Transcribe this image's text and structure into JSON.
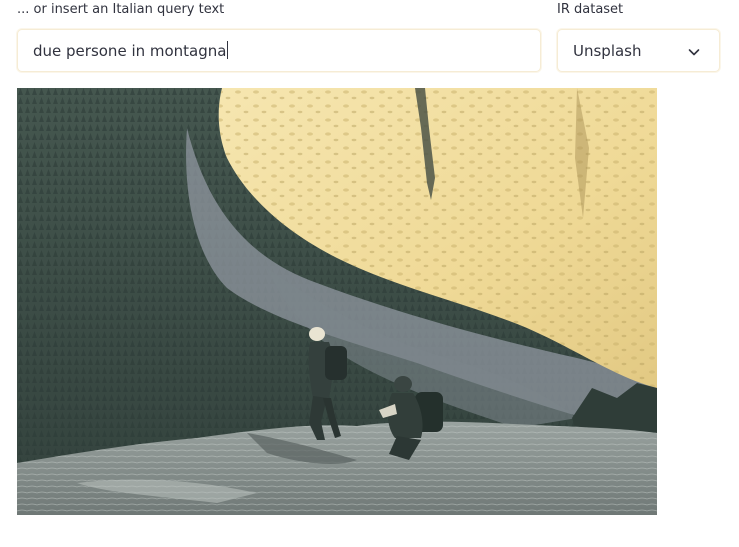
{
  "query": {
    "label": "... or insert an Italian query text",
    "value": "due persone in montagna"
  },
  "dataset": {
    "label": "IR dataset",
    "selected": "Unsplash",
    "icon": "chevron-down-icon"
  },
  "result": {
    "icon": "photo-two-hikers-on-mountain-ledge"
  },
  "colors": {
    "field_border": "#f6ecd5",
    "text": "#31333f",
    "sunlit_cliff": "#f2dfa2",
    "forest": "#3b4a46"
  }
}
